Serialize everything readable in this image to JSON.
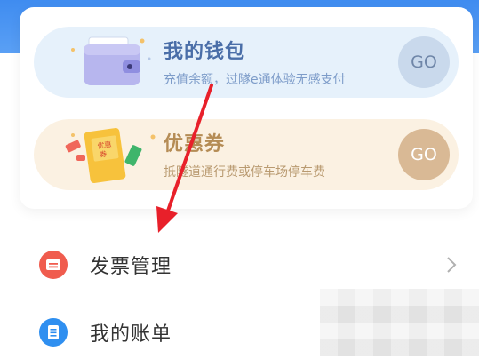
{
  "wallet": {
    "title": "我的钱包",
    "subtitle": "充值余额，过隧e通体验无感支付",
    "go_label": "GO"
  },
  "coupon": {
    "title": "优惠券",
    "subtitle": "抵隧道通行费或停车场停车费",
    "go_label": "GO",
    "badge_text": "优惠券"
  },
  "menu": {
    "invoice_label": "发票管理",
    "bill_label": "我的账单"
  },
  "colors": {
    "header_blue": "#3f8cf0",
    "invoice_icon": "#f05c4e",
    "bill_icon": "#2f8ff0",
    "annotation_arrow": "#e8202a"
  },
  "icons": {
    "wallet": "wallet-icon",
    "coupon": "coupon-icon",
    "invoice": "ticket-icon",
    "bill": "document-icon",
    "chevron": "chevron-right-icon"
  }
}
